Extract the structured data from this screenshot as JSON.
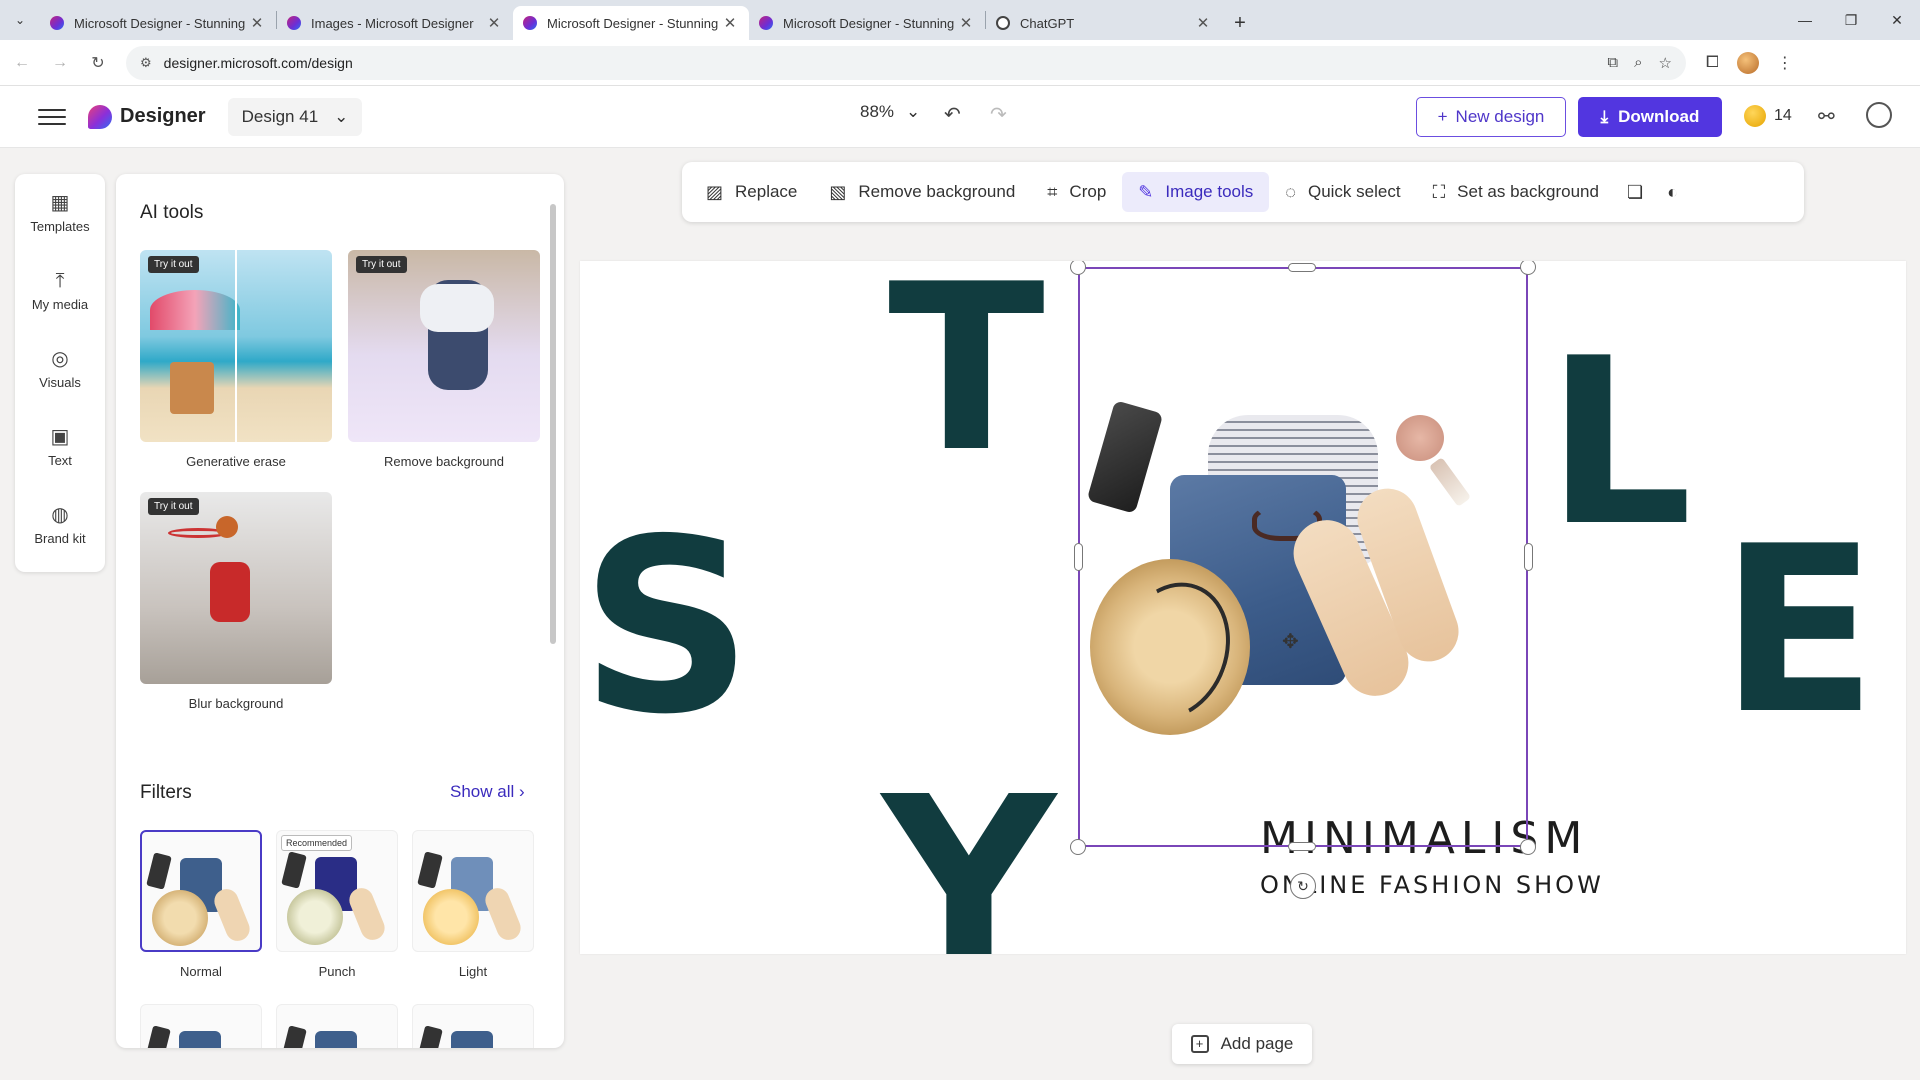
{
  "browser": {
    "tabs": [
      {
        "title": "Microsoft Designer - Stunning",
        "active": false
      },
      {
        "title": "Images - Microsoft Designer",
        "active": false
      },
      {
        "title": "Microsoft Designer - Stunning",
        "active": true
      },
      {
        "title": "Microsoft Designer - Stunning",
        "active": false
      },
      {
        "title": "ChatGPT",
        "active": false
      }
    ],
    "url": "designer.microsoft.com/design"
  },
  "header": {
    "brand": "Designer",
    "design_name": "Design 41",
    "zoom": "88%",
    "new_design_label": "New design",
    "download_label": "Download",
    "credits": "14"
  },
  "rail": {
    "items": [
      {
        "label": "Templates",
        "icon": "templates-icon"
      },
      {
        "label": "My media",
        "icon": "upload-icon"
      },
      {
        "label": "Visuals",
        "icon": "visuals-icon"
      },
      {
        "label": "Text",
        "icon": "text-icon"
      },
      {
        "label": "Brand kit",
        "icon": "palette-icon"
      }
    ]
  },
  "panel": {
    "ai_tools_title": "AI tools",
    "try_badge": "Try it out",
    "ai_tools": [
      {
        "label": "Generative erase"
      },
      {
        "label": "Remove background"
      },
      {
        "label": "Blur background"
      }
    ],
    "filters_title": "Filters",
    "show_all": "Show all",
    "recommended_badge": "Recommended",
    "filters": [
      {
        "label": "Normal",
        "selected": true
      },
      {
        "label": "Punch",
        "selected": false
      },
      {
        "label": "Light",
        "selected": false
      }
    ]
  },
  "image_toolbar": {
    "replace": "Replace",
    "remove_background": "Remove background",
    "crop": "Crop",
    "image_tools": "Image tools",
    "quick_select": "Quick select",
    "set_as_background": "Set as background"
  },
  "canvas": {
    "letter_s": "S",
    "letter_t": "T",
    "letter_y": "Y",
    "letter_l": "L",
    "letter_e": "E",
    "caption_main": "MINIMALISM",
    "caption_sub": "ONLINE FASHION SHOW"
  },
  "footer": {
    "add_page": "Add page"
  },
  "colors": {
    "accent": "#5236e0",
    "text_dark_teal": "#113c3f",
    "selection": "#7a46b8"
  }
}
